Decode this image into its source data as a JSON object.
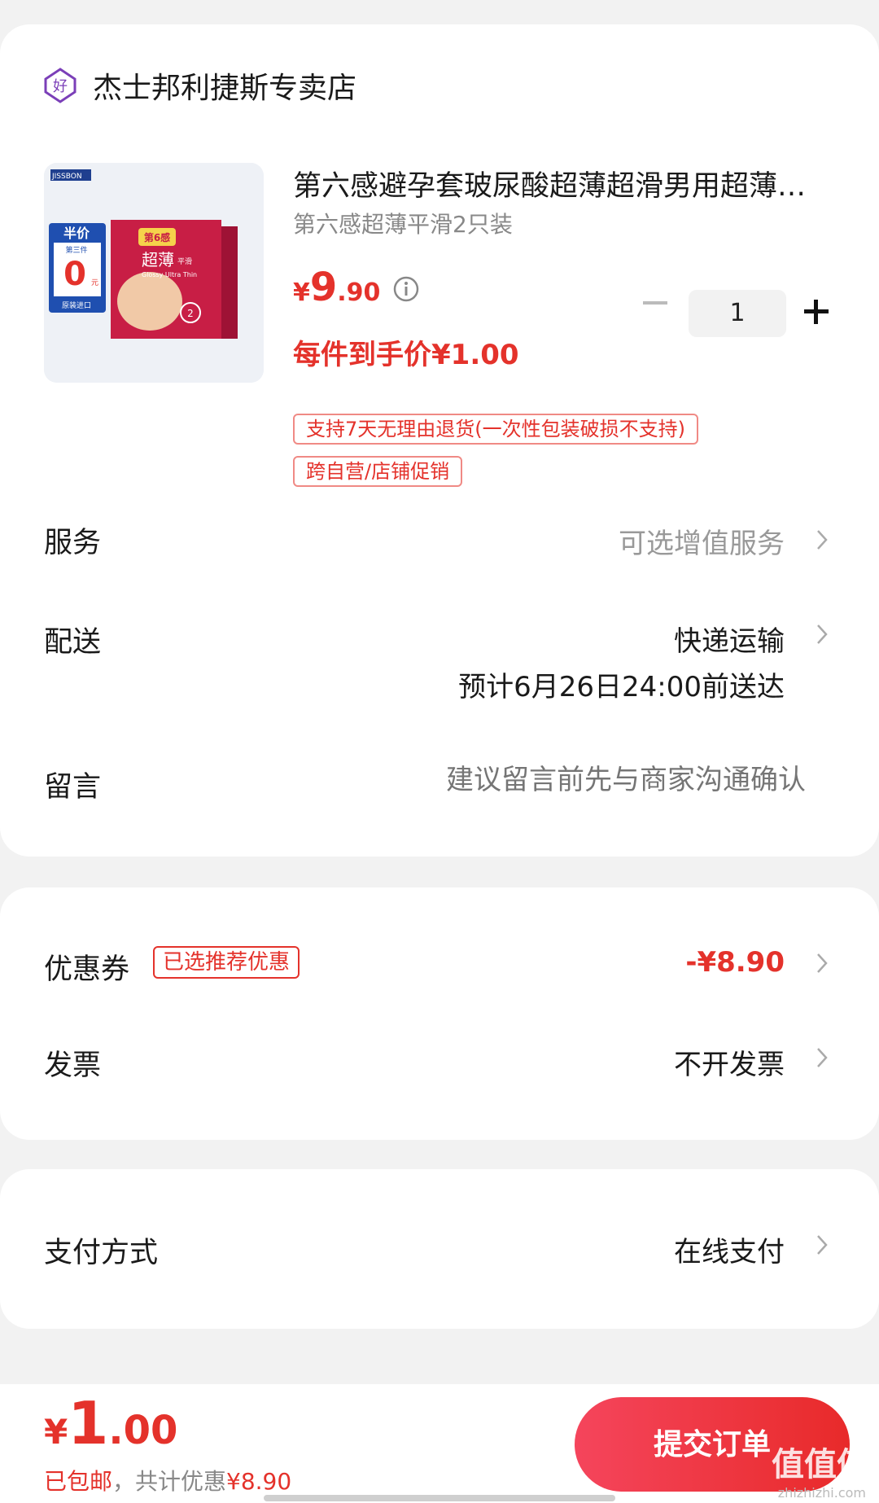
{
  "store": {
    "name": "杰士邦利捷斯专卖店",
    "icon_text": "好"
  },
  "product": {
    "brand": "JISSBON",
    "box_badge_top": "半价",
    "box_badge_sub": "第三件",
    "box_badge_value": "0",
    "box_badge_unit": "元",
    "box_badge_foot": "原装进口",
    "box_brand": "第6感",
    "box_title": "超薄",
    "box_title_small": "平滑",
    "box_sub": "Glossy Ultra Thin",
    "box_count": "2",
    "title": "第六感避孕套玻尿酸超薄超滑男用超薄安全套",
    "spec": "第六感超薄平滑2只装",
    "price_symbol": "¥",
    "price_int": "9",
    "price_dec": ".90",
    "quantity": "1",
    "final_price": "每件到手价¥1.00",
    "tags": [
      "支持7天无理由退货(一次性包装破损不支持)",
      "跨自营/店铺促销"
    ]
  },
  "rows": {
    "service": {
      "label": "服务",
      "value": "可选增值服务"
    },
    "delivery": {
      "label": "配送",
      "value": "快递运输",
      "eta": "预计6月26日24:00前送达"
    },
    "message": {
      "label": "留言",
      "placeholder": "建议留言前先与商家沟通确认"
    },
    "coupon": {
      "label": "优惠券",
      "badge": "已选推荐优惠",
      "value": "-¥8.90"
    },
    "invoice": {
      "label": "发票",
      "value": "不开发票"
    },
    "payment": {
      "label": "支付方式",
      "value": "在线支付"
    }
  },
  "footer": {
    "total_symbol": "¥",
    "total_int": "1",
    "total_dec": ".00",
    "shipping": "已包邮",
    "discount_prefix": "，共计优惠",
    "discount_value": "¥8.90",
    "submit": "提交订单",
    "watermark": "值值值",
    "watermark_url": "zhizhizhi.com"
  },
  "colors": {
    "accent": "#e4322b",
    "background": "#f2f2f2",
    "store_icon": "#7b3fb8"
  }
}
